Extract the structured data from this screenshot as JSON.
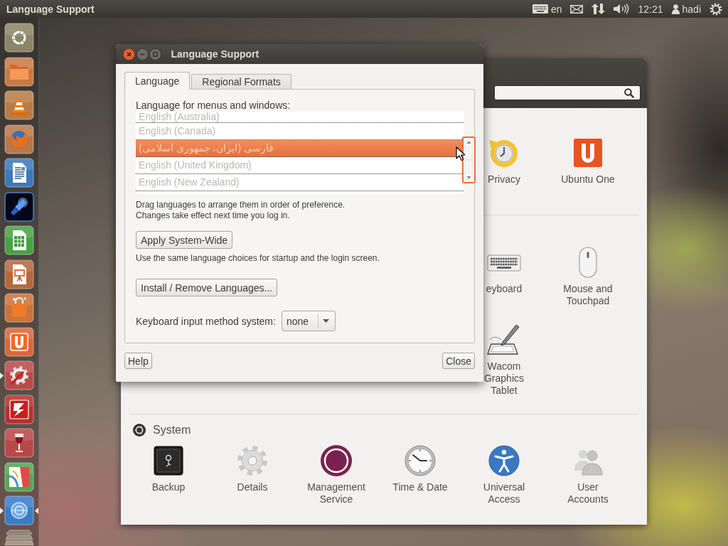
{
  "top_panel": {
    "title": "Language Support",
    "indicators": [
      {
        "kind": "keyboard",
        "label": "en"
      },
      {
        "kind": "mail"
      },
      {
        "kind": "network"
      },
      {
        "kind": "sound"
      },
      {
        "kind": "clock",
        "label": "12:21"
      },
      {
        "kind": "user",
        "label": "hadi"
      },
      {
        "kind": "session"
      }
    ]
  },
  "launcher": [
    {
      "kind": "dash",
      "running": false,
      "focused": false
    },
    {
      "kind": "files",
      "running": false,
      "focused": false
    },
    {
      "kind": "cone",
      "running": false,
      "focused": false
    },
    {
      "kind": "browser",
      "running": false,
      "focused": false
    },
    {
      "kind": "writer",
      "running": false,
      "focused": false
    },
    {
      "kind": "glow",
      "running": false,
      "focused": false
    },
    {
      "kind": "calc",
      "running": false,
      "focused": false
    },
    {
      "kind": "impress",
      "running": false,
      "focused": false
    },
    {
      "kind": "store",
      "running": false,
      "focused": false
    },
    {
      "kind": "cloud",
      "running": false,
      "focused": false
    },
    {
      "kind": "settings",
      "running": true,
      "focused": false
    },
    {
      "kind": "ftp",
      "running": false,
      "focused": false
    },
    {
      "kind": "wine",
      "running": false,
      "focused": false
    },
    {
      "kind": "map",
      "running": false,
      "focused": false
    },
    {
      "kind": "language",
      "running": true,
      "focused": true
    },
    {
      "kind": "folded",
      "running": false,
      "focused": false
    }
  ],
  "settings_window": {
    "sections": [
      {
        "items": [
          {
            "kind": "privacy",
            "label": "Privacy"
          },
          {
            "kind": "cloud",
            "label": "Ubuntu One"
          }
        ]
      },
      {
        "items": [
          {
            "kind": "keyboard",
            "label": "eyboard"
          },
          {
            "kind": "mouse",
            "label": "Mouse and Touchpad"
          },
          {
            "kind": "tablet",
            "label": "Wacom Graphics Tablet"
          }
        ]
      },
      {
        "title": "System",
        "items": [
          {
            "kind": "backup",
            "label": "Backup"
          },
          {
            "kind": "details",
            "label": "Details"
          },
          {
            "kind": "management",
            "label": "Management Service"
          },
          {
            "kind": "time",
            "label": "Time & Date"
          },
          {
            "kind": "access",
            "label": "Universal Access"
          },
          {
            "kind": "users",
            "label": "User Accounts"
          }
        ]
      }
    ]
  },
  "dialog": {
    "title": "Language Support",
    "tabs": [
      {
        "label": "Language",
        "selected": true
      },
      {
        "label": "Regional Formats",
        "selected": false
      }
    ],
    "list_label": "Language for menus and windows:",
    "languages": [
      {
        "name": "English (Australia)",
        "selected": false
      },
      {
        "name": "English (Canada)",
        "selected": false
      },
      {
        "name": "فارسی (ایران، جمهوری اسلامی)",
        "selected": true
      },
      {
        "name": "English (United Kingdom)",
        "selected": false
      },
      {
        "name": "English (New Zealand)",
        "selected": false
      }
    ],
    "hint": [
      "Drag languages to arrange them in order of preference.",
      "Changes take effect next time you log in."
    ],
    "apply_button": "Apply System-Wide",
    "apply_note": "Use the same language choices for startup and the login screen.",
    "install_button": "Install / Remove Languages...",
    "input_method": {
      "label": "Keyboard input method system:",
      "value": "none"
    },
    "help_button": "Help",
    "close_button": "Close"
  }
}
